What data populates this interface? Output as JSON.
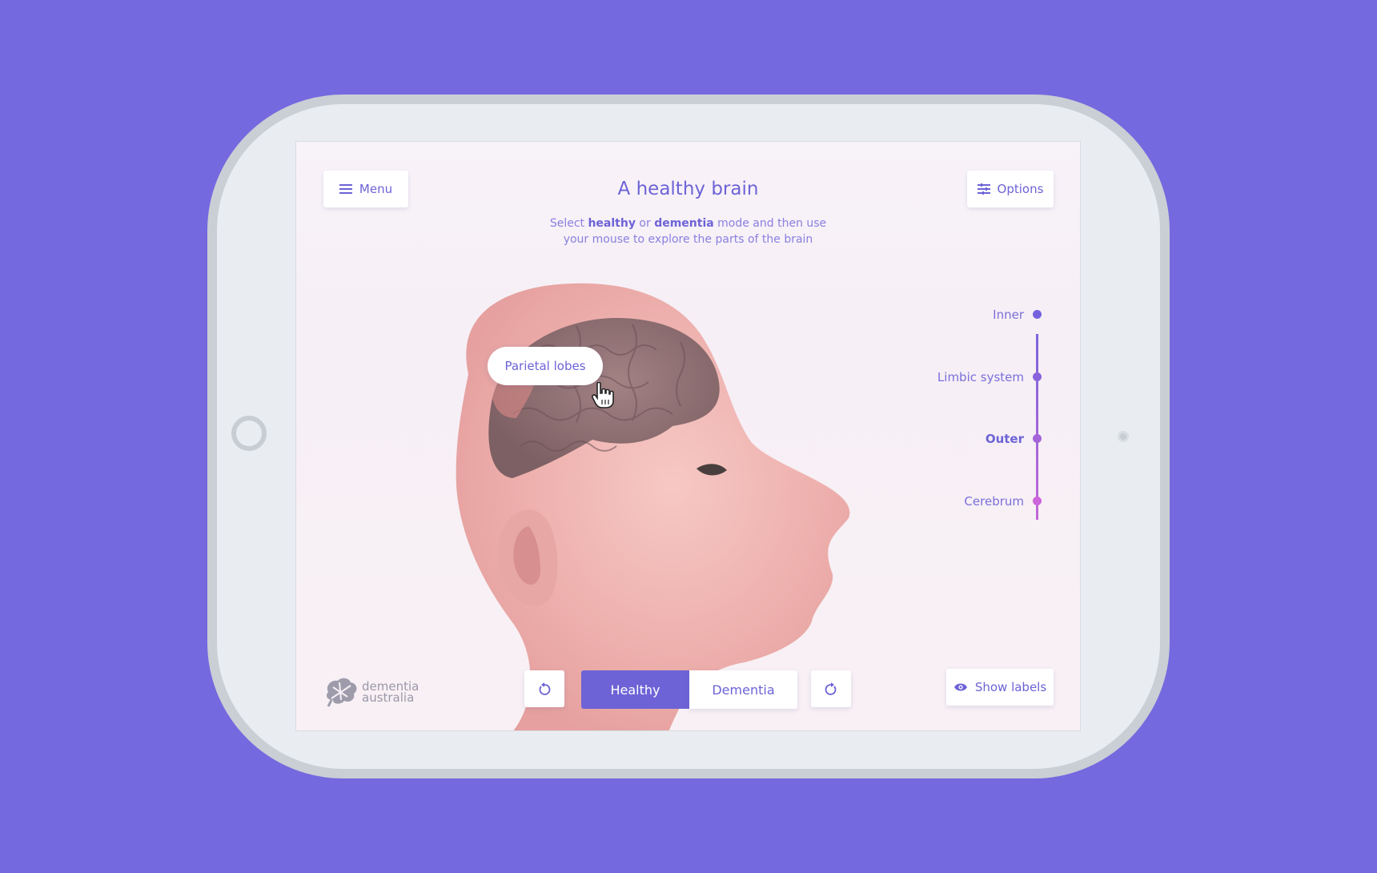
{
  "header": {
    "menu_label": "Menu",
    "options_label": "Options",
    "title": "A healthy brain",
    "subtitle_pre": "Select ",
    "subtitle_healthy": "healthy",
    "subtitle_or": " or ",
    "subtitle_dementia": "dementia",
    "subtitle_post": " mode and then use",
    "subtitle_line2": "your mouse to explore the parts of the brain"
  },
  "tooltip": {
    "label": "Parietal lobes"
  },
  "layers": [
    {
      "label": "Inner",
      "active": false,
      "color": "#7562dc"
    },
    {
      "label": "Limbic system",
      "active": false,
      "color": "#8a62dc"
    },
    {
      "label": "Outer",
      "active": true,
      "color": "#a464da"
    },
    {
      "label": "Cerebrum",
      "active": false,
      "color": "#cd65dc"
    }
  ],
  "mode_toggle": {
    "healthy_label": "Healthy",
    "dementia_label": "Dementia",
    "selected": "Healthy"
  },
  "footer": {
    "show_labels": "Show labels",
    "logo_line1": "dementia",
    "logo_line2": "australia"
  },
  "icons": {
    "menu": "hamburger-icon",
    "options": "sliders-icon",
    "rotate_left": "rotate-left-icon",
    "rotate_right": "rotate-right-icon",
    "show_labels": "eye-icon",
    "cursor": "hand-cursor-icon"
  },
  "colors": {
    "accent": "#6d63d6",
    "background": "#7469df",
    "device_frame": "#c9cfd4"
  }
}
